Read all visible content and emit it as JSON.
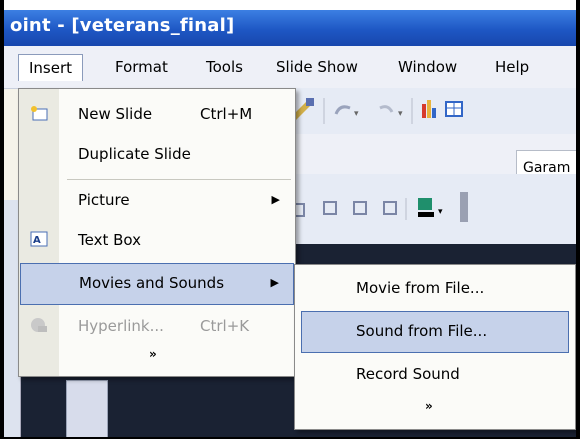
{
  "window": {
    "title": "oint - [veterans_final]"
  },
  "menubar": {
    "items": [
      {
        "label": "Insert"
      },
      {
        "label": "Format"
      },
      {
        "label": "Tools"
      },
      {
        "label": "Slide Show"
      },
      {
        "label": "Window"
      },
      {
        "label": "Help"
      }
    ]
  },
  "toolbar": {
    "font_name": "Garam"
  },
  "insert_menu": {
    "items": [
      {
        "label": "New Slide",
        "shortcut": "Ctrl+M"
      },
      {
        "label": "Duplicate Slide"
      },
      {
        "label": "Picture"
      },
      {
        "label": "Text Box"
      },
      {
        "label": "Movies and Sounds"
      },
      {
        "label": "Hyperlink...",
        "shortcut": "Ctrl+K"
      }
    ],
    "more": "»"
  },
  "movies_sounds_menu": {
    "items": [
      {
        "label": "Movie from File..."
      },
      {
        "label": "Sound from File..."
      },
      {
        "label": "Record Sound"
      }
    ],
    "more": "»"
  },
  "colors": {
    "titlebar": "#1e57c4",
    "highlight": "#c6d2ea",
    "highlight_border": "#4b6fb0"
  }
}
